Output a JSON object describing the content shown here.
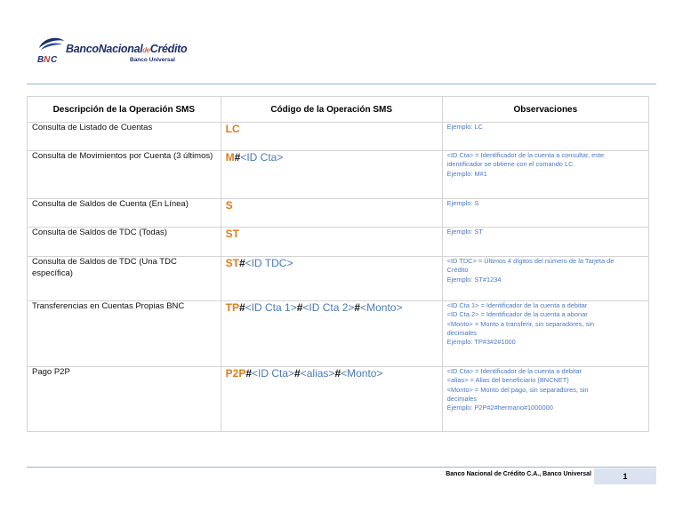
{
  "brand": {
    "name_main": "BancoNacional",
    "name_de": "de",
    "name_end": "Crédito",
    "subtitle": "Banco Universal",
    "abbr": "BNC",
    "colors": {
      "navy": "#1d2f6e",
      "red": "#c0392b",
      "orange": "#e07b1a",
      "blue": "#4a78c4"
    }
  },
  "table": {
    "headers": [
      "Descripción de la Operación SMS",
      "Código de la Operación SMS",
      "Observaciones"
    ],
    "rows": [
      {
        "description": "Consulta de Listado de Cuentas",
        "code": [
          {
            "text": "LC",
            "kind": "cmd"
          }
        ],
        "observations": [
          "Ejemplo: LC"
        ]
      },
      {
        "description": "Consulta de Movimientos por Cuenta (3 últimos)",
        "code": [
          {
            "text": "M",
            "kind": "cmd"
          },
          {
            "text": "#",
            "kind": "sep"
          },
          {
            "text": "<ID Cta>",
            "kind": "param"
          }
        ],
        "observations": [
          "<ID Cta> = Identificador de la cuenta a consultar, este",
          "identificador se obtiene con el comando LC.",
          "Ejemplo: M#1"
        ]
      },
      {
        "description": "Consulta de Saldos de Cuenta (En Línea)",
        "code": [
          {
            "text": "S",
            "kind": "cmd"
          }
        ],
        "observations": [
          "Ejemplo: S"
        ]
      },
      {
        "description": "Consulta de Saldos de TDC (Todas)",
        "code": [
          {
            "text": "ST",
            "kind": "cmd"
          }
        ],
        "observations": [
          "Ejemplo: ST"
        ]
      },
      {
        "description": "Consulta de Saldos de TDC (Una TDC específica)",
        "code": [
          {
            "text": "ST",
            "kind": "cmd"
          },
          {
            "text": "#",
            "kind": "sep"
          },
          {
            "text": "<ID TDC>",
            "kind": "param"
          }
        ],
        "observations": [
          "<ID TDC> = Últimos 4 dígitos del número de la Tarjeta de",
          "Crédito",
          "Ejemplo: ST#1234"
        ]
      },
      {
        "description": "Transferencias en Cuentas Propias BNC",
        "code": [
          {
            "text": "TP",
            "kind": "cmd"
          },
          {
            "text": "#",
            "kind": "sep"
          },
          {
            "text": "<ID Cta 1>",
            "kind": "param"
          },
          {
            "text": "#",
            "kind": "sep"
          },
          {
            "text": "<ID Cta 2>",
            "kind": "param"
          },
          {
            "text": "#",
            "kind": "sep"
          },
          {
            "text": "<Monto>",
            "kind": "param"
          }
        ],
        "observations": [
          "<ID Cta 1> = Identificador de la cuenta a debitar",
          "<ID Cta 2> = Identificador de la cuenta a abonar",
          "<Monto> = Monto a transferir, sin separadores, sin",
          "decimales",
          "Ejemplo: TP#3#2#1000"
        ]
      },
      {
        "description": "Pago P2P",
        "code": [
          {
            "text": "P2P",
            "kind": "cmd"
          },
          {
            "text": "#",
            "kind": "sep"
          },
          {
            "text": "<ID Cta>",
            "kind": "param"
          },
          {
            "text": "#",
            "kind": "sep"
          },
          {
            "text": "<alias>",
            "kind": "param"
          },
          {
            "text": "#",
            "kind": "sep"
          },
          {
            "text": "<Monto>",
            "kind": "param"
          }
        ],
        "observations": [
          "<ID Cta> = Identificador de la cuenta a debitar",
          "<alias> = Alias del beneficiario (BNCNET)",
          "<Monto> = Monto del pago, sin separadores, sin",
          "decimales",
          "Ejemplo: P2P#2#hermano#1000000"
        ]
      }
    ]
  },
  "footer": {
    "company": "Banco Nacional de Crédito C.A., Banco Universal",
    "page_number": "1"
  }
}
